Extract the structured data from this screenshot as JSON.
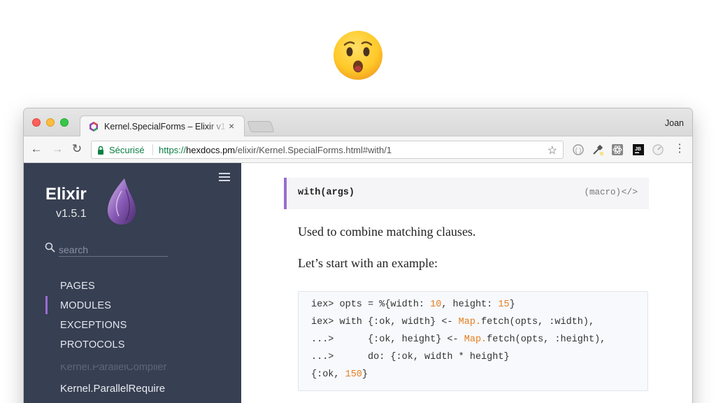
{
  "emoji": {
    "name": "hushed-face"
  },
  "browser": {
    "tab_title": "Kernel.SpecialForms – Elixir v1",
    "tab_close": "×",
    "profile_name": "Joan",
    "security_label": "Sécurisé",
    "url": {
      "scheme": "https://",
      "host": "hexdocs.pm",
      "path": "/elixir/Kernel.SpecialForms.html#with/1"
    },
    "accent": "#0b8043"
  },
  "sidebar": {
    "project_name": "Elixir",
    "project_version": "v1.5.1",
    "search_placeholder": "search",
    "nav": [
      {
        "label": "PAGES"
      },
      {
        "label": "MODULES",
        "active": true
      },
      {
        "label": "EXCEPTIONS"
      },
      {
        "label": "PROTOCOLS"
      }
    ],
    "faded_item": "Kernel.ParallelCompiler",
    "module_item": "Kernel.ParallelRequire",
    "background": "#373f52",
    "accent": "#9b6bd3"
  },
  "main": {
    "signature": "with(args)",
    "kind": "(macro)",
    "source_icon": "</>",
    "paragraphs": [
      "Used to combine matching clauses.",
      "Let’s start with an example:"
    ],
    "code": [
      [
        {
          "t": "iex> opts = %{width: "
        },
        {
          "t": "10",
          "c": "num"
        },
        {
          "t": ", height: "
        },
        {
          "t": "15",
          "c": "num"
        },
        {
          "t": "}"
        }
      ],
      [
        {
          "t": "iex> with {:ok, width} <- "
        },
        {
          "t": "Map.",
          "c": "mod"
        },
        {
          "t": "fetch(opts, :width),"
        }
      ],
      [
        {
          "t": "...>      {:ok, height} <- "
        },
        {
          "t": "Map.",
          "c": "mod"
        },
        {
          "t": "fetch(opts, :height),"
        }
      ],
      [
        {
          "t": "...>      do: {:ok, width * height}"
        }
      ],
      [
        {
          "t": "{:ok, "
        },
        {
          "t": "150",
          "c": "num"
        },
        {
          "t": "}"
        }
      ]
    ]
  }
}
